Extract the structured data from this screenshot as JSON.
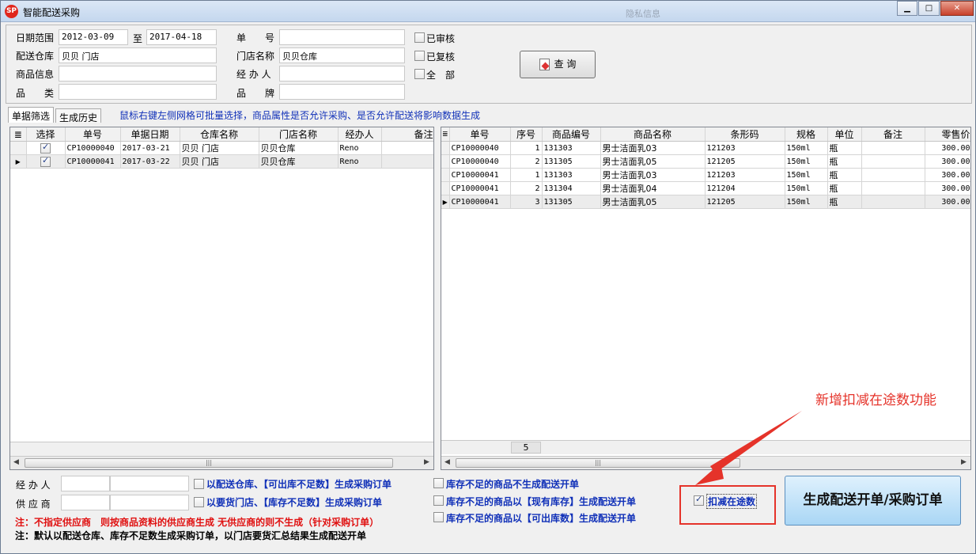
{
  "window": {
    "title": "智能配送采购",
    "title_ghost": "隐私信息",
    "minimize_glyph": "▁",
    "maximize_glyph": "□",
    "close_glyph": "✕",
    "app_icon_text": "SP"
  },
  "filters": {
    "date_range_label": "日期范围",
    "date_from": "2012-03-09",
    "to_label": "至",
    "date_to": "2017-04-18",
    "warehouse_label": "配送仓库",
    "warehouse_value": "贝贝 门店",
    "product_info_label": "商品信息",
    "product_info_value": "",
    "category_label": "品　　类",
    "category_value": "",
    "order_no_label": "单　　号",
    "order_no_value": "",
    "store_name_label": "门店名称",
    "store_name_value": "贝贝仓库",
    "handler_label": "经 办 人",
    "handler_value": "",
    "brand_label": "品　　牌",
    "brand_value": "",
    "approved_label": "已审核",
    "reviewed_label": "已复核",
    "all_label": "全　部",
    "query_button": "查 询"
  },
  "tabs": [
    "单据筛选",
    "生成历史"
  ],
  "hint": "鼠标右键左侧网格可批量选择，商品属性是否允许采购、是否允许配送将影响数据生成",
  "left_grid": {
    "columns": [
      "选择",
      "单号",
      "单据日期",
      "仓库名称",
      "门店名称",
      "经办人",
      "备注"
    ],
    "rows": [
      {
        "selected": true,
        "order_no": "CP10000040",
        "date": "2017-03-21",
        "warehouse": "贝贝 门店",
        "store": "贝贝仓库",
        "handler": "Reno",
        "remark": ""
      },
      {
        "selected": true,
        "order_no": "CP10000041",
        "date": "2017-03-22",
        "warehouse": "贝贝 门店",
        "store": "贝贝仓库",
        "handler": "Reno",
        "remark": ""
      }
    ]
  },
  "right_grid": {
    "columns": [
      "单号",
      "序号",
      "商品编号",
      "商品名称",
      "条形码",
      "规格",
      "单位",
      "备注",
      "零售价"
    ],
    "rows": [
      {
        "order_no": "CP10000040",
        "seq": "1",
        "code": "131303",
        "name": "男士洁面乳03",
        "barcode": "121203",
        "spec": "150ml",
        "unit": "瓶",
        "remark": "",
        "price": "300.00"
      },
      {
        "order_no": "CP10000040",
        "seq": "2",
        "code": "131305",
        "name": "男士洁面乳05",
        "barcode": "121205",
        "spec": "150ml",
        "unit": "瓶",
        "remark": "",
        "price": "300.00"
      },
      {
        "order_no": "CP10000041",
        "seq": "1",
        "code": "131303",
        "name": "男士洁面乳03",
        "barcode": "121203",
        "spec": "150ml",
        "unit": "瓶",
        "remark": "",
        "price": "300.00"
      },
      {
        "order_no": "CP10000041",
        "seq": "2",
        "code": "131304",
        "name": "男士洁面乳04",
        "barcode": "121204",
        "spec": "150ml",
        "unit": "瓶",
        "remark": "",
        "price": "300.00"
      },
      {
        "order_no": "CP10000041",
        "seq": "3",
        "code": "131305",
        "name": "男士洁面乳05",
        "barcode": "121205",
        "spec": "150ml",
        "unit": "瓶",
        "remark": "",
        "price": "300.00"
      }
    ],
    "footer_count": "5"
  },
  "bottom": {
    "handler_label": "经 办 人",
    "supplier_label": "供 应 商",
    "opt1": "以配送仓库、【可出库不足数】生成采购订单",
    "opt2": "以要货门店、【库存不足数】生成采购订单",
    "opt3": "库存不足的商品不生成配送开单",
    "opt4": "库存不足的商品以【现有库存】生成配送开单",
    "opt5": "库存不足的商品以【可出库数】生成配送开单",
    "deduct_label": "扣减在途数",
    "note_red": "注：不指定供应商　则按商品资料的供应商生成 无供应商的则不生成（针对采购订单）",
    "note_black": "注：默认以配送仓库、库存不足数生成采购订单，以门店要货汇总结果生成配送开单",
    "generate_button": "生成配送开单/采购订单"
  },
  "annotation": {
    "text": "新增扣减在途数功能",
    "color": "#e5332a"
  },
  "colors": {
    "accent_blue": "#1030b8",
    "note_red": "#e01010",
    "button_blue": "#a9d6f5"
  }
}
